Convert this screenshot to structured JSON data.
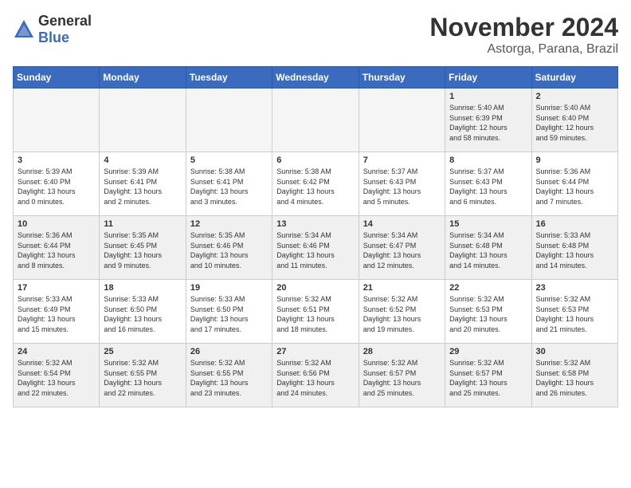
{
  "logo": {
    "text_general": "General",
    "text_blue": "Blue"
  },
  "header": {
    "month": "November 2024",
    "location": "Astorga, Parana, Brazil"
  },
  "weekdays": [
    "Sunday",
    "Monday",
    "Tuesday",
    "Wednesday",
    "Thursday",
    "Friday",
    "Saturday"
  ],
  "weeks": [
    [
      {
        "day": "",
        "detail": "",
        "empty": true
      },
      {
        "day": "",
        "detail": "",
        "empty": true
      },
      {
        "day": "",
        "detail": "",
        "empty": true
      },
      {
        "day": "",
        "detail": "",
        "empty": true
      },
      {
        "day": "",
        "detail": "",
        "empty": true
      },
      {
        "day": "1",
        "detail": "Sunrise: 5:40 AM\nSunset: 6:39 PM\nDaylight: 12 hours\nand 58 minutes."
      },
      {
        "day": "2",
        "detail": "Sunrise: 5:40 AM\nSunset: 6:40 PM\nDaylight: 12 hours\nand 59 minutes."
      }
    ],
    [
      {
        "day": "3",
        "detail": "Sunrise: 5:39 AM\nSunset: 6:40 PM\nDaylight: 13 hours\nand 0 minutes."
      },
      {
        "day": "4",
        "detail": "Sunrise: 5:39 AM\nSunset: 6:41 PM\nDaylight: 13 hours\nand 2 minutes."
      },
      {
        "day": "5",
        "detail": "Sunrise: 5:38 AM\nSunset: 6:41 PM\nDaylight: 13 hours\nand 3 minutes."
      },
      {
        "day": "6",
        "detail": "Sunrise: 5:38 AM\nSunset: 6:42 PM\nDaylight: 13 hours\nand 4 minutes."
      },
      {
        "day": "7",
        "detail": "Sunrise: 5:37 AM\nSunset: 6:43 PM\nDaylight: 13 hours\nand 5 minutes."
      },
      {
        "day": "8",
        "detail": "Sunrise: 5:37 AM\nSunset: 6:43 PM\nDaylight: 13 hours\nand 6 minutes."
      },
      {
        "day": "9",
        "detail": "Sunrise: 5:36 AM\nSunset: 6:44 PM\nDaylight: 13 hours\nand 7 minutes."
      }
    ],
    [
      {
        "day": "10",
        "detail": "Sunrise: 5:36 AM\nSunset: 6:44 PM\nDaylight: 13 hours\nand 8 minutes."
      },
      {
        "day": "11",
        "detail": "Sunrise: 5:35 AM\nSunset: 6:45 PM\nDaylight: 13 hours\nand 9 minutes."
      },
      {
        "day": "12",
        "detail": "Sunrise: 5:35 AM\nSunset: 6:46 PM\nDaylight: 13 hours\nand 10 minutes."
      },
      {
        "day": "13",
        "detail": "Sunrise: 5:34 AM\nSunset: 6:46 PM\nDaylight: 13 hours\nand 11 minutes."
      },
      {
        "day": "14",
        "detail": "Sunrise: 5:34 AM\nSunset: 6:47 PM\nDaylight: 13 hours\nand 12 minutes."
      },
      {
        "day": "15",
        "detail": "Sunrise: 5:34 AM\nSunset: 6:48 PM\nDaylight: 13 hours\nand 14 minutes."
      },
      {
        "day": "16",
        "detail": "Sunrise: 5:33 AM\nSunset: 6:48 PM\nDaylight: 13 hours\nand 14 minutes."
      }
    ],
    [
      {
        "day": "17",
        "detail": "Sunrise: 5:33 AM\nSunset: 6:49 PM\nDaylight: 13 hours\nand 15 minutes."
      },
      {
        "day": "18",
        "detail": "Sunrise: 5:33 AM\nSunset: 6:50 PM\nDaylight: 13 hours\nand 16 minutes."
      },
      {
        "day": "19",
        "detail": "Sunrise: 5:33 AM\nSunset: 6:50 PM\nDaylight: 13 hours\nand 17 minutes."
      },
      {
        "day": "20",
        "detail": "Sunrise: 5:32 AM\nSunset: 6:51 PM\nDaylight: 13 hours\nand 18 minutes."
      },
      {
        "day": "21",
        "detail": "Sunrise: 5:32 AM\nSunset: 6:52 PM\nDaylight: 13 hours\nand 19 minutes."
      },
      {
        "day": "22",
        "detail": "Sunrise: 5:32 AM\nSunset: 6:53 PM\nDaylight: 13 hours\nand 20 minutes."
      },
      {
        "day": "23",
        "detail": "Sunrise: 5:32 AM\nSunset: 6:53 PM\nDaylight: 13 hours\nand 21 minutes."
      }
    ],
    [
      {
        "day": "24",
        "detail": "Sunrise: 5:32 AM\nSunset: 6:54 PM\nDaylight: 13 hours\nand 22 minutes."
      },
      {
        "day": "25",
        "detail": "Sunrise: 5:32 AM\nSunset: 6:55 PM\nDaylight: 13 hours\nand 22 minutes."
      },
      {
        "day": "26",
        "detail": "Sunrise: 5:32 AM\nSunset: 6:55 PM\nDaylight: 13 hours\nand 23 minutes."
      },
      {
        "day": "27",
        "detail": "Sunrise: 5:32 AM\nSunset: 6:56 PM\nDaylight: 13 hours\nand 24 minutes."
      },
      {
        "day": "28",
        "detail": "Sunrise: 5:32 AM\nSunset: 6:57 PM\nDaylight: 13 hours\nand 25 minutes."
      },
      {
        "day": "29",
        "detail": "Sunrise: 5:32 AM\nSunset: 6:57 PM\nDaylight: 13 hours\nand 25 minutes."
      },
      {
        "day": "30",
        "detail": "Sunrise: 5:32 AM\nSunset: 6:58 PM\nDaylight: 13 hours\nand 26 minutes."
      }
    ]
  ]
}
